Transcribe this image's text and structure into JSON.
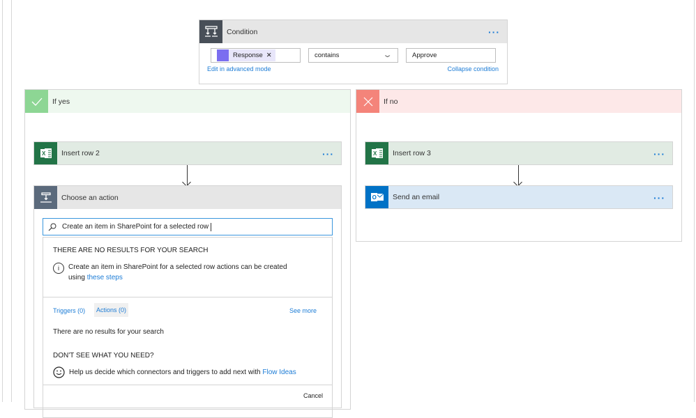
{
  "condition": {
    "title": "Condition",
    "left_token": "Response",
    "operator": "contains",
    "right_value": "Approve",
    "edit_advanced": "Edit in advanced mode",
    "collapse": "Collapse condition",
    "icon": "condition-icon"
  },
  "if_yes": {
    "label": "If yes",
    "color": "#8dd694",
    "icon": "check-icon",
    "insert_row": {
      "title": "Insert row 2",
      "icon": "excel-icon"
    },
    "choose_action": {
      "title": "Choose an action",
      "search_value": "Create an item in SharePoint for a selected row",
      "no_results_heading": "THERE ARE NO RESULTS FOR YOUR SEARCH",
      "info_text": "Create an item in SharePoint for a selected row actions can be created using",
      "info_link": "these steps",
      "tabs": [
        {
          "label": "Triggers (0)"
        },
        {
          "label": "Actions (0)"
        }
      ],
      "see_more": "See more",
      "no_results_text": "There are no results for your search",
      "dont_see": "DON'T SEE WHAT YOU NEED?",
      "help_text": "Help us decide which connectors and triggers to add next with",
      "help_link": "Flow Ideas",
      "cancel": "Cancel"
    }
  },
  "if_no": {
    "label": "If no",
    "color": "#f4847a",
    "icon": "x-icon",
    "insert_row": {
      "title": "Insert row 3",
      "icon": "excel-icon"
    },
    "send_email": {
      "title": "Send an email",
      "icon": "outlook-icon"
    }
  },
  "menu_label": "···"
}
